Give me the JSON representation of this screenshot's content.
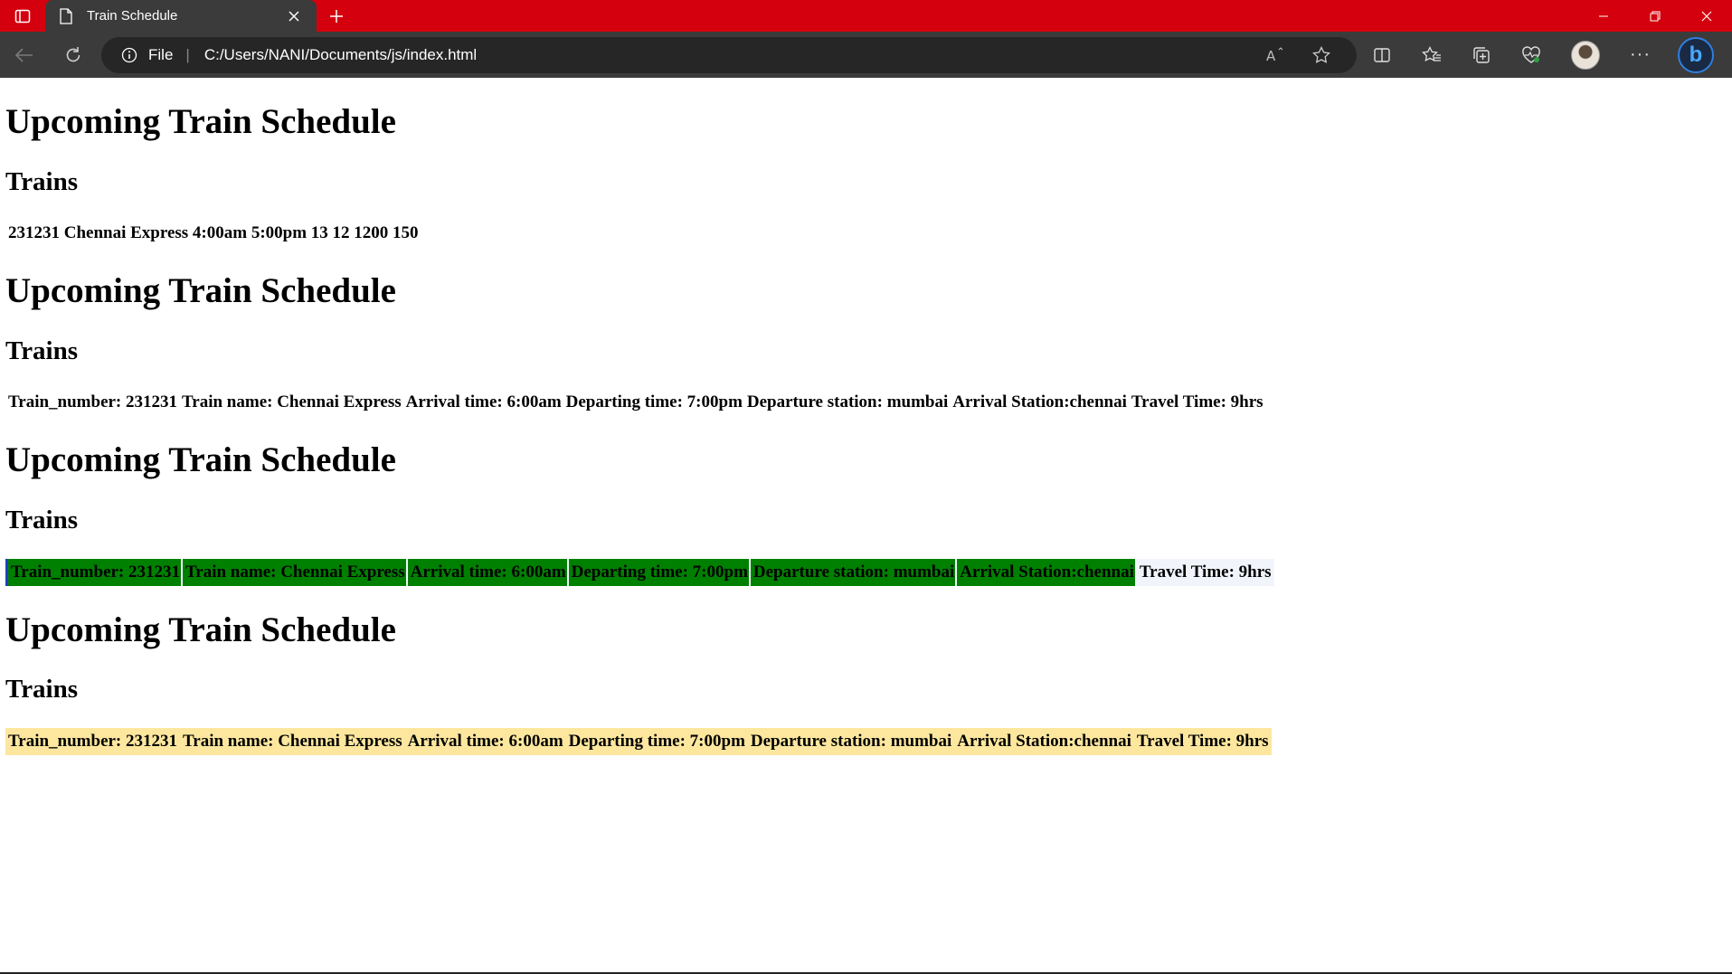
{
  "browser": {
    "tab_title": "Train Schedule",
    "address_prefix": "File",
    "url": "C:/Users/NANI/Documents/js/index.html",
    "icons": [
      "tab-actions-icon",
      "document-icon",
      "close-icon",
      "plus-icon",
      "back-icon",
      "refresh-icon",
      "info-icon",
      "read-aloud-icon",
      "star-icon",
      "split-screen-icon",
      "favorites-icon",
      "collections-icon",
      "browser-essentials-icon",
      "profile-avatar",
      "more-icon",
      "bing-icon",
      "minimize-icon",
      "restore-icon",
      "window-close-icon"
    ],
    "read_aloud_label": "A",
    "more_label": "···",
    "bing_label": "b"
  },
  "sections": [
    {
      "heading": "Upcoming Train Schedule",
      "subheading": "Trains",
      "row": "231231 Chennai Express 4:00am 5:00pm 13 12 1200 150"
    },
    {
      "heading": "Upcoming Train Schedule",
      "subheading": "Trains",
      "cells": [
        "Train_number: 231231",
        "Train name: Chennai Express",
        "Arrival time: 6:00am",
        "Departing time: 7:00pm",
        "Departure station: mumbai",
        "Arrival Station:chennai",
        "Travel Time: 9hrs"
      ]
    },
    {
      "heading": "Upcoming Train Schedule",
      "subheading": "Trains",
      "cells": [
        "Train_number: 231231",
        "Train name: Chennai Express",
        "Arrival time: 6:00am",
        "Departing time: 7:00pm",
        "Departure station: mumbai",
        "Arrival Station:chennai",
        "Travel Time: 9hrs"
      ],
      "highlight_color": "#008000"
    },
    {
      "heading": "Upcoming Train Schedule",
      "subheading": "Trains",
      "cells": [
        "Train_number: 231231",
        "Train name: Chennai Express",
        "Arrival time: 6:00am",
        "Departing time: 7:00pm",
        "Departure station: mumbai",
        "Arrival Station:chennai",
        "Travel Time: 9hrs"
      ],
      "highlight_color": "#fde79e"
    }
  ],
  "colors": {
    "titlebar": "#d4000e",
    "toolbar": "#3b3b3b",
    "address_bar": "#262626"
  }
}
